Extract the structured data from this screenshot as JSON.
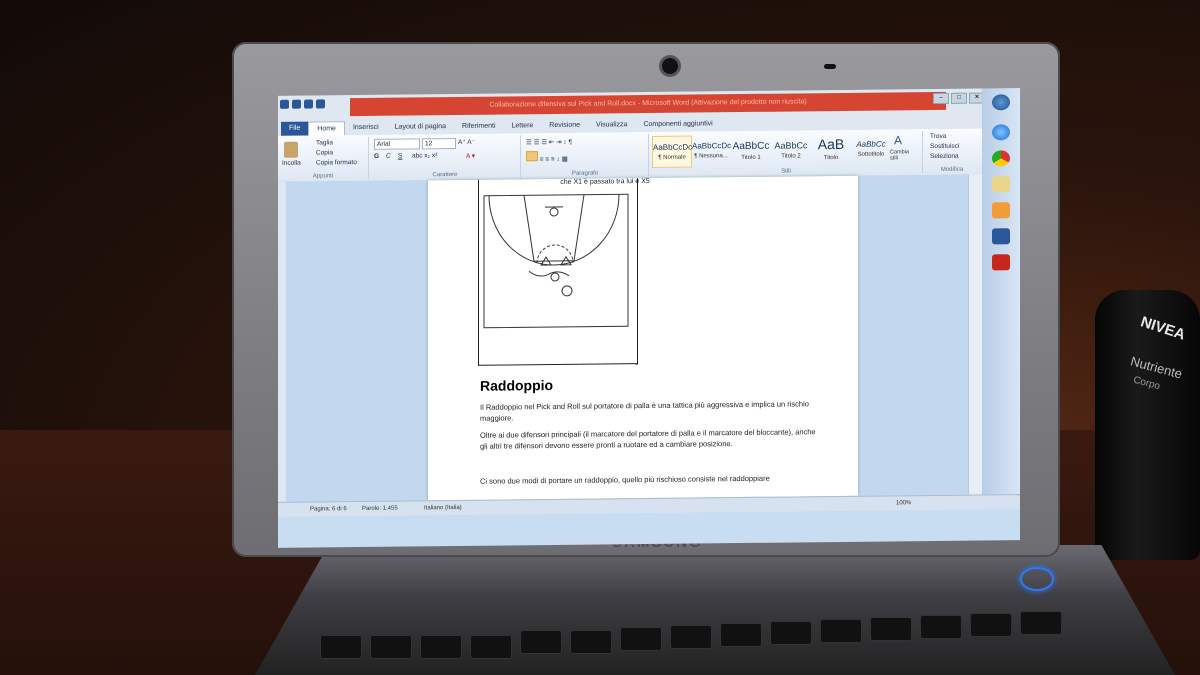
{
  "window": {
    "title": "Collaborazione difensiva sul Pick and Roll.docx - Microsoft Word (Attivazione del prodotto non riuscita)",
    "tabs": [
      "File",
      "Home",
      "Inserisci",
      "Layout di pagina",
      "Riferimenti",
      "Lettere",
      "Revisione",
      "Visualizza",
      "Componenti aggiuntivi"
    ],
    "active_tab": "Home"
  },
  "ribbon": {
    "clipboard": {
      "paste": "Incolla",
      "cut": "Taglia",
      "copy": "Copia",
      "format_painter": "Copia formato",
      "label": "Appunti"
    },
    "font": {
      "name": "Arial",
      "size": "12",
      "bold": "G",
      "italic": "C",
      "underline": "S",
      "label": "Carattere"
    },
    "paragraph": {
      "label": "Paragrafo"
    },
    "styles": {
      "items": [
        {
          "preview": "AaBbCcDc",
          "name": "¶ Normale"
        },
        {
          "preview": "AaBbCcDc",
          "name": "¶ Nessuna..."
        },
        {
          "preview": "AaBbCc",
          "name": "Titolo 1"
        },
        {
          "preview": "AaBbCc",
          "name": "Titolo 2"
        },
        {
          "preview": "AaB",
          "name": "Titolo"
        },
        {
          "preview": "AaBbCc",
          "name": "Sottotitolo"
        }
      ],
      "change_styles": "Cambia stili",
      "label": "Stili"
    },
    "editing": {
      "find": "Trova",
      "replace": "Sostituisci",
      "select": "Seleziona",
      "label": "Modifica"
    }
  },
  "document": {
    "caption": "che X1 è passato tra lui e X5",
    "heading": "Raddoppio",
    "p1": "Il Raddoppio nel Pick and Roll sul portatore di palla è una tattica più aggressiva e implica un rischio maggiore.",
    "p2": "Oltre ai due difensori principali (il marcatore del portatore di palla e il marcatore del bloccante), anche gli altri tre difensori devono essere pronti a ruotare ed a cambiare posizione.",
    "p3": "Ci sono due modi di portare un raddoppio, quello più rischioso consiste nel raddoppiare"
  },
  "statusbar": {
    "page": "Pagina: 6 di 6",
    "words": "Parole: 1.455",
    "language": "Italiano (Italia)",
    "zoom": "100%"
  },
  "laptop": {
    "brand": "SAMSUNG"
  },
  "bottle": {
    "brand": "NIVEA",
    "line1": "Nutriente",
    "line2": "Corpo"
  }
}
